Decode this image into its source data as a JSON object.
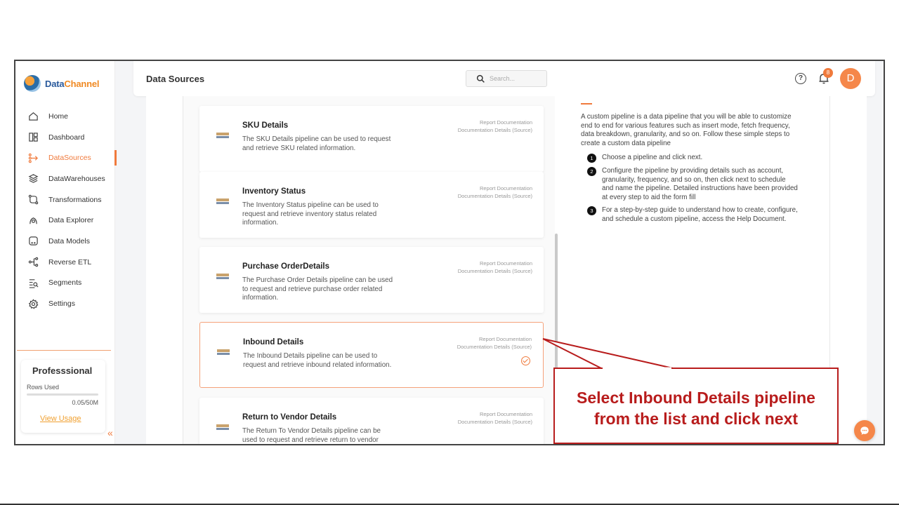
{
  "brand": {
    "name_part1": "Data",
    "name_part2": "Channel"
  },
  "sidebar": {
    "items": [
      {
        "label": "Home",
        "icon": "home-icon"
      },
      {
        "label": "Dashboard",
        "icon": "dashboard-icon"
      },
      {
        "label": "DataSources",
        "icon": "datasources-icon",
        "active": true
      },
      {
        "label": "DataWarehouses",
        "icon": "datawarehouses-icon"
      },
      {
        "label": "Transformations",
        "icon": "transformations-icon"
      },
      {
        "label": "Data Explorer",
        "icon": "data-explorer-icon"
      },
      {
        "label": "Data Models",
        "icon": "data-models-icon"
      },
      {
        "label": "Reverse ETL",
        "icon": "reverse-etl-icon"
      },
      {
        "label": "Segments",
        "icon": "segments-icon"
      },
      {
        "label": "Settings",
        "icon": "settings-icon"
      }
    ],
    "plan": {
      "title": "Professsional",
      "rows_label": "Rows Used",
      "rows_value": "0.05/50M",
      "view_usage": "View Usage"
    }
  },
  "header": {
    "title": "Data Sources",
    "search_placeholder": "Search...",
    "notification_count": "8",
    "avatar_initial": "D",
    "help_glyph": "?"
  },
  "pipelines": [
    {
      "title": "SKU Details",
      "description": "The SKU Details pipeline can be used to request and retrieve SKU related information.",
      "link1": "Report Documentation",
      "link2": "Documentation Details (Source)"
    },
    {
      "title": "Inventory Status",
      "description": "The Inventory Status pipeline can be used to request and retrieve inventory status related information.",
      "link1": "Report Documentation",
      "link2": "Documentation Details (Source)"
    },
    {
      "title": "Purchase OrderDetails",
      "description": "The Purchase Order Details pipeline can be used to request and retrieve purchase order related information.",
      "link1": "Report Documentation",
      "link2": "Documentation Details (Source)"
    },
    {
      "title": "Inbound Details",
      "description": "The Inbound Details pipeline can be used to request and retrieve inbound related information.",
      "link1": "Report Documentation",
      "link2": "Documentation Details (Source)",
      "selected": true
    },
    {
      "title": "Return to Vendor Details",
      "description": "The Return To Vendor Details pipeline can be used to request and retrieve return to vendor",
      "link1": "Report Documentation",
      "link2": "Documentation Details (Source)"
    }
  ],
  "info": {
    "intro": "A custom pipeline is a data pipeline that you will be able to customize end to end for various features such as insert mode, fetch frequency, data breakdown, granularity, and so on. Follow these simple steps to create a custom data pipeline",
    "steps": [
      {
        "num": "1",
        "text": "Choose a pipeline and click next."
      },
      {
        "num": "2",
        "text": "Configure the pipeline by providing details such as account, granularity, frequency, and so on, then click next to schedule and name the pipeline. Detailed instructions have been provided at every step to aid the form fill"
      },
      {
        "num": "3",
        "text": "For a step-by-step guide to understand how to create, configure, and schedule a custom pipeline, access the Help Document."
      }
    ]
  },
  "callout": {
    "line1": "Select Inbound  Details pipeline",
    "line2": "from the list and click next"
  },
  "colors": {
    "accent": "#f07a3c",
    "callout": "#b81c1c"
  }
}
